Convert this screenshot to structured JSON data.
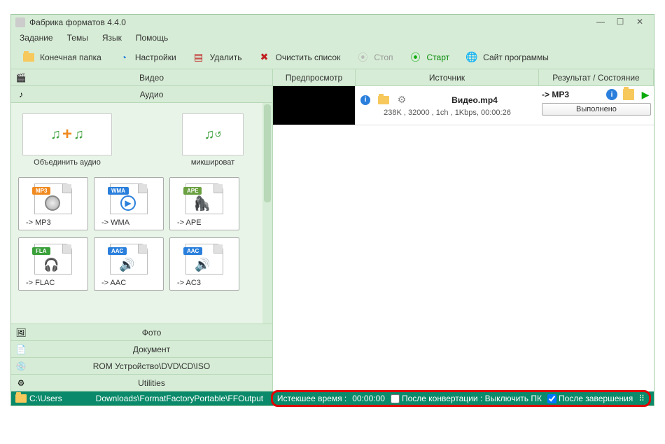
{
  "window": {
    "title": "Фабрика форматов 4.4.0"
  },
  "menu": {
    "task": "Задание",
    "themes": "Темы",
    "lang": "Язык",
    "help": "Помощь"
  },
  "toolbar": {
    "output_folder": "Конечная папка",
    "settings": "Настройки",
    "delete": "Удалить",
    "clear_list": "Очистить список",
    "stop": "Стоп",
    "start": "Старт",
    "website": "Сайт программы"
  },
  "categories": {
    "video": "Видео",
    "audio": "Аудио",
    "photo": "Фото",
    "document": "Документ",
    "rom": "ROM Устройство\\DVD\\CD\\ISO",
    "utilities": "Utilities"
  },
  "audio_actions": {
    "join": "Объединить аудио",
    "mix": "микшироват"
  },
  "formats": {
    "mp3": {
      "label": "-> MP3",
      "badge": "MP3",
      "color": "#f08a20"
    },
    "wma": {
      "label": "-> WMA",
      "badge": "WMA",
      "color": "#2a7fdc"
    },
    "ape": {
      "label": "-> APE",
      "badge": "APE",
      "color": "#6aa040"
    },
    "flac": {
      "label": "-> FLAC",
      "badge": "FLA",
      "color": "#3aa03a"
    },
    "aac": {
      "label": "-> AAC",
      "badge": "AAC",
      "color": "#2a7fdc"
    },
    "ac3": {
      "label": "-> AC3",
      "badge": "AAC",
      "color": "#2a7fdc"
    }
  },
  "columns": {
    "preview": "Предпросмотр",
    "source": "Источник",
    "result": "Результат / Состояние"
  },
  "file": {
    "name": "Видео.mp4",
    "info": "238K , 32000 , 1ch , 1Kbps, 00:00:26",
    "result_format": "-> MP3",
    "status": "Выполнено"
  },
  "status": {
    "path_prefix": "C:\\Users",
    "path_suffix": "Downloads\\FormatFactoryPortable\\FFOutput",
    "elapsed_label": "Истекшее время :",
    "elapsed_value": "00:00:00",
    "after_conv": "После конвертации : Выключить ПК",
    "after_done": "После завершения"
  }
}
